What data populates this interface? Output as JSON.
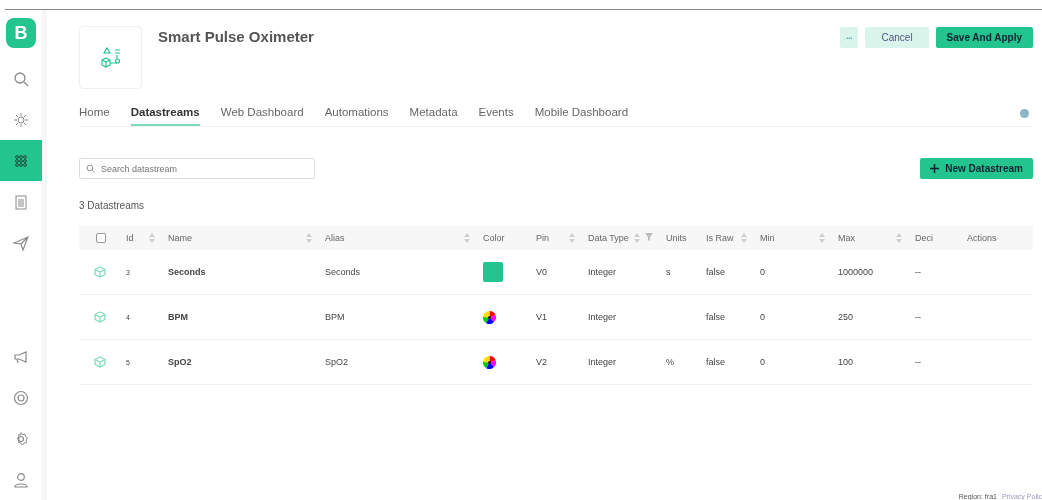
{
  "sidebar": {
    "logo": "B",
    "items": [
      {
        "selected": false
      },
      {
        "selected": false
      },
      {
        "selected": true
      },
      {
        "selected": false
      },
      {
        "selected": false
      }
    ]
  },
  "header": {
    "title": "Smart Pulse Oximeter",
    "more": "•••",
    "cancel": "Cancel",
    "save": "Save And Apply"
  },
  "tabs": [
    {
      "label": "Home",
      "selected": false
    },
    {
      "label": "Datastreams",
      "selected": true
    },
    {
      "label": "Web Dashboard",
      "selected": false
    },
    {
      "label": "Automations",
      "selected": false
    },
    {
      "label": "Metadata",
      "selected": false
    },
    {
      "label": "Events",
      "selected": false
    },
    {
      "label": "Mobile Dashboard",
      "selected": false
    }
  ],
  "search": {
    "placeholder": "Search datastream"
  },
  "new_button": "New Datastream",
  "count": "3 Datastreams",
  "table": {
    "select_all": {
      "checked": false
    },
    "columns": [
      {
        "label": "Id",
        "sortable": true,
        "filter": false
      },
      {
        "label": "Name",
        "sortable": true,
        "filter": false
      },
      {
        "label": "Alias",
        "sortable": true,
        "filter": false
      },
      {
        "label": "Color",
        "sortable": false,
        "filter": false
      },
      {
        "label": "Pin",
        "sortable": true,
        "filter": false
      },
      {
        "label": "Data Type",
        "sortable": true,
        "filter": true
      },
      {
        "label": "Units",
        "sortable": false,
        "filter": false
      },
      {
        "label": "Is Raw",
        "sortable": true,
        "filter": false
      },
      {
        "label": "Min",
        "sortable": true,
        "filter": false
      },
      {
        "label": "Max",
        "sortable": true,
        "filter": false
      },
      {
        "label": "Deci",
        "sortable": false,
        "filter": false
      },
      {
        "label": "Actions",
        "sortable": false,
        "filter": false
      }
    ],
    "rows": [
      {
        "id": "3",
        "name": "Seconds",
        "alias": "Seconds",
        "color": "#23c48e",
        "pin": "V0",
        "data_type": "Integer",
        "units": "s",
        "is_raw": "false",
        "min": "0",
        "max": "1000000",
        "decimals": "--"
      },
      {
        "id": "4",
        "name": "BPM",
        "alias": "BPM",
        "pin": "V1",
        "data_type": "Integer",
        "is_raw": "false",
        "min": "0",
        "max": "250",
        "decimals": "--"
      },
      {
        "id": "5",
        "name": "SpO2",
        "alias": "SpO2",
        "pin": "V2",
        "data_type": "Integer",
        "units": "%",
        "is_raw": "false",
        "min": "0",
        "max": "100",
        "decimals": "--"
      }
    ]
  },
  "footer": {
    "region": "Region: fra1",
    "privacy": "Privacy Polic"
  }
}
